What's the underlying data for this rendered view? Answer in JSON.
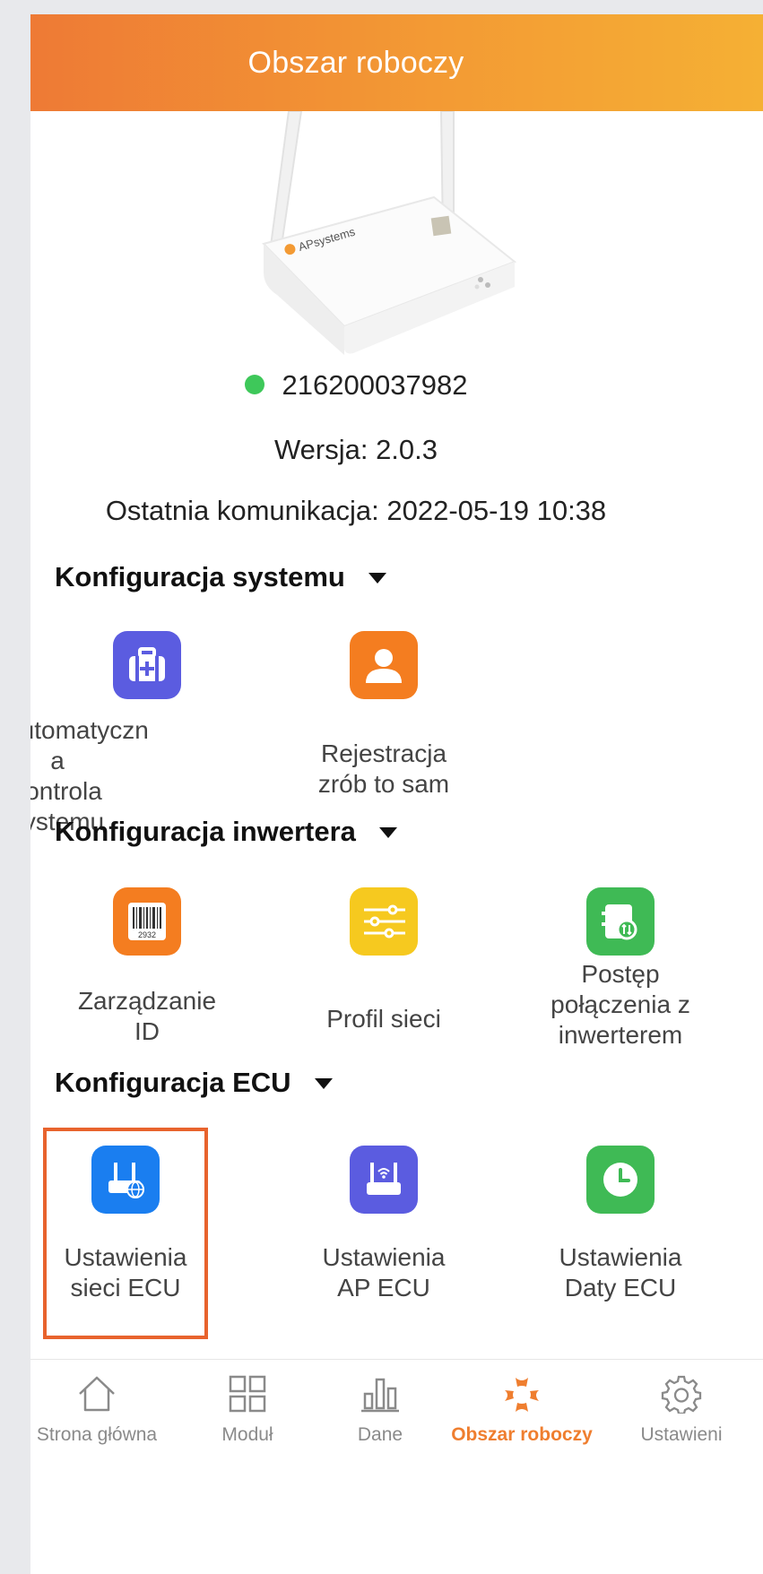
{
  "header": {
    "title": "Obszar roboczy"
  },
  "device": {
    "serial": "216200037982",
    "status_color": "#3ec85a",
    "version": "Wersja: 2.0.3",
    "last_comm": "Ostatnia komunikacja: 2022-05-19 10:38",
    "brand_label": "APsystems"
  },
  "sections": [
    {
      "title": "Konfiguracja systemu",
      "items": [
        {
          "label": "Automatyczn\na kontrola\nsystemu",
          "icon": "medical-kit-icon",
          "color": "#5b5ce0"
        },
        {
          "label": "Rejestracja\nzrób to sam",
          "icon": "user-icon",
          "color": "#f47d20"
        }
      ]
    },
    {
      "title": "Konfiguracja inwertera",
      "items": [
        {
          "label": "Zarządzanie\nID",
          "icon": "barcode-icon",
          "color": "#f47d20",
          "barcode_number": "2932"
        },
        {
          "label": "Profil sieci",
          "icon": "sliders-icon",
          "color": "#f6c91f"
        },
        {
          "label": "Postęp\npołączenia z\ninwerterem",
          "icon": "inverter-sync-icon",
          "color": "#3fba55"
        }
      ]
    },
    {
      "title": "Konfiguracja ECU",
      "items": [
        {
          "label": "Ustawienia\nsieci ECU",
          "icon": "router-globe-icon",
          "color": "#1a7ef0"
        },
        {
          "label": "Ustawienia\nAP ECU",
          "icon": "router-wifi-icon",
          "color": "#5b5ce0"
        },
        {
          "label": "Ustawienia\nDaty ECU",
          "icon": "clock-icon",
          "color": "#3fba55"
        }
      ]
    }
  ],
  "bottom_nav": [
    {
      "label": "Strona główna",
      "icon": "home-icon"
    },
    {
      "label": "Moduł",
      "icon": "grid-icon"
    },
    {
      "label": "Dane",
      "icon": "bar-chart-icon"
    },
    {
      "label": "Obszar roboczy",
      "icon": "apsystems-logo-icon",
      "active": true
    },
    {
      "label": "Ustawieni",
      "icon": "gear-icon"
    }
  ],
  "colors": {
    "accent": "#ef7e2f",
    "highlight_border": "#e8632d"
  }
}
